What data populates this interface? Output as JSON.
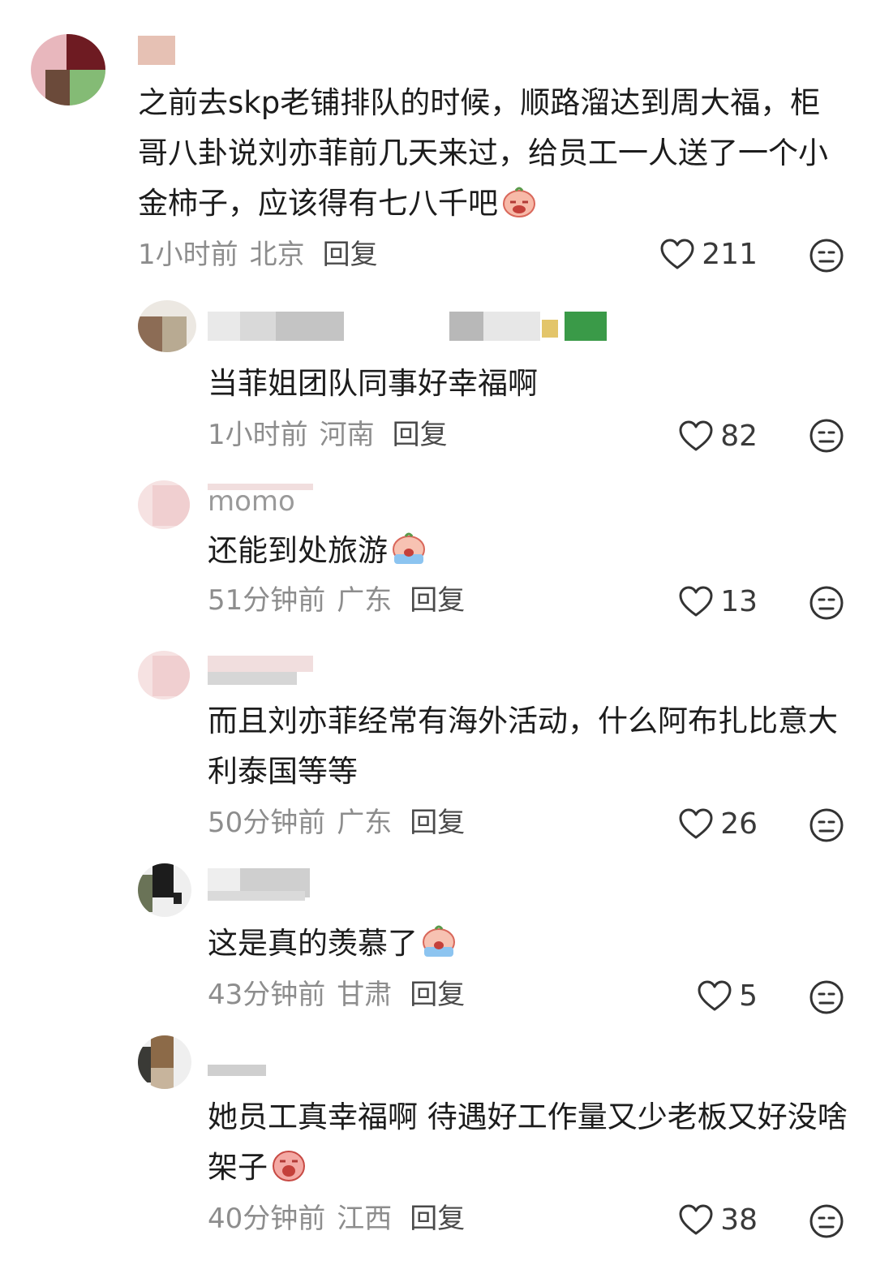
{
  "comments": [
    {
      "text": "之前去skp老铺排队的时候，顺路溜达到周大福，柜哥八卦说刘亦菲前几天来过，给员工一人送了一个小金柿子，应该得有七八千吧",
      "time": "1小时前",
      "location": "北京",
      "reply": "回复",
      "likes": "211",
      "emoji": "crying-face-emoji"
    },
    {
      "text": "当菲姐团队同事好幸福啊",
      "time": "1小时前",
      "location": "河南",
      "reply": "回复",
      "likes": "82"
    },
    {
      "username_visible": "momo",
      "text": "还能到处旅游",
      "time": "51分钟前",
      "location": "广东",
      "reply": "回复",
      "likes": "13",
      "emoji": "crying-face-emoji"
    },
    {
      "text": "而且刘亦菲经常有海外活动，什么阿布扎比意大利泰国等等",
      "time": "50分钟前",
      "location": "广东",
      "reply": "回复",
      "likes": "26"
    },
    {
      "text": "这是真的羡慕了",
      "time": "43分钟前",
      "location": "甘肃",
      "reply": "回复",
      "likes": "5",
      "emoji": "crying-face-emoji"
    },
    {
      "text": "她员工真幸福啊 待遇好工作量又少老板又好没啥架子",
      "time": "40分钟前",
      "location": "江西",
      "reply": "回复",
      "likes": "38",
      "emoji": "crying-face-emoji"
    }
  ],
  "colors": {
    "text": "#1c1c1c",
    "meta": "#8d8d8d",
    "reply": "#4a4a4a",
    "icon": "#333333"
  },
  "icons": [
    "heart-outline-icon",
    "neutral-face-icon"
  ]
}
